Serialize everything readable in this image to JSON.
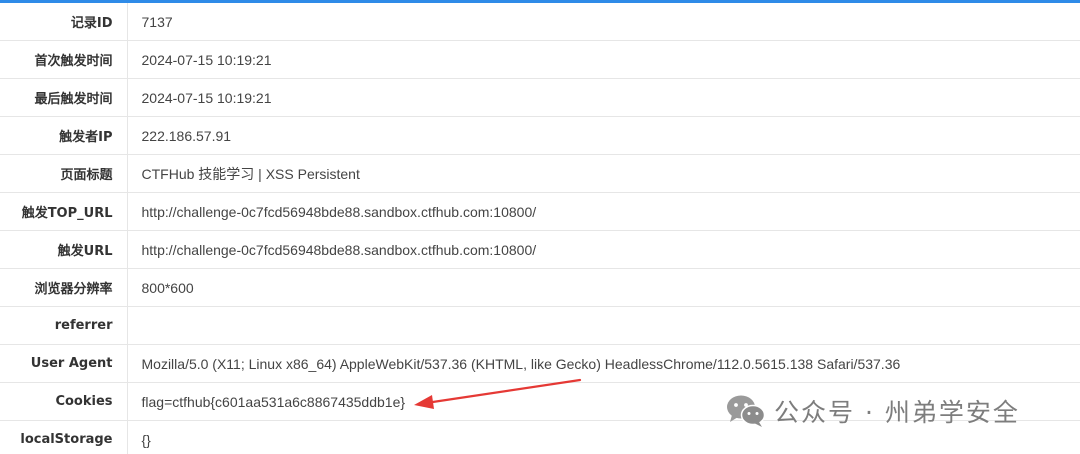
{
  "rows": [
    {
      "label": "记录ID",
      "value": "7137"
    },
    {
      "label": "首次触发时间",
      "value": "2024-07-15 10:19:21"
    },
    {
      "label": "最后触发时间",
      "value": "2024-07-15 10:19:21"
    },
    {
      "label": "触发者IP",
      "value": "222.186.57.91"
    },
    {
      "label": "页面标题",
      "value": "CTFHub 技能学习 | XSS Persistent"
    },
    {
      "label": "触发TOP_URL",
      "value": "http://challenge-0c7fcd56948bde88.sandbox.ctfhub.com:10800/"
    },
    {
      "label": "触发URL",
      "value": "http://challenge-0c7fcd56948bde88.sandbox.ctfhub.com:10800/"
    },
    {
      "label": "浏览器分辨率",
      "value": "800*600"
    },
    {
      "label": "referrer",
      "value": ""
    },
    {
      "label": "User Agent",
      "value": "Mozilla/5.0 (X11; Linux x86_64) AppleWebKit/537.36 (KHTML, like Gecko) HeadlessChrome/112.0.5615.138 Safari/537.36"
    },
    {
      "label": "Cookies",
      "value": "flag=ctfhub{c601aa531a6c8867435ddb1e}"
    },
    {
      "label": "localStorage",
      "value": "{}"
    }
  ],
  "watermark": {
    "text": "公众号 · 州弟学安全",
    "icon": "wechat-icon"
  },
  "annotation": {
    "icon": "red-arrow-icon",
    "color": "#e53935"
  },
  "colors": {
    "accent_bar": "#2f8be8",
    "border": "#e6e6e6",
    "label_text": "#333333",
    "value_text": "#444444"
  }
}
